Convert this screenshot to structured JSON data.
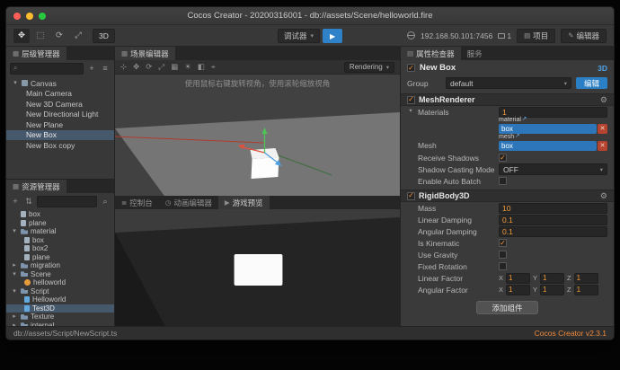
{
  "icons": {
    "chevron_down": "▾",
    "chevron_right": "▸",
    "check": "✓",
    "close": "✕",
    "plus": "+",
    "search": "⌕",
    "menu": "≡",
    "gear": "⚙",
    "play": "▶",
    "arrow_out": "↗",
    "sort": "⇅",
    "grid": "▦",
    "list": "≣",
    "clock": "◷",
    "pencil": "✎",
    "panel": "▤"
  },
  "window": {
    "title": "Cocos Creator - 20200316001 - db://assets/Scene/helloworld.fire"
  },
  "toolbar": {
    "tools": [
      "✥",
      "⬚",
      "⟳",
      "⤢"
    ],
    "mode_3d_label": "3D",
    "debugger_label": "调试器",
    "address": "192.168.50.101:7456",
    "device_count": "1",
    "project_label": "项目",
    "editor_label": "编辑器"
  },
  "hierarchy": {
    "title": "层级管理器",
    "items": [
      {
        "label": "Canvas"
      },
      {
        "label": "Main Camera"
      },
      {
        "label": "New 3D Camera"
      },
      {
        "label": "New Directional Light"
      },
      {
        "label": "New Plane"
      },
      {
        "label": "New Box"
      },
      {
        "label": "New Box copy"
      }
    ]
  },
  "assets": {
    "title": "资源管理器",
    "items": [
      {
        "label": "box"
      },
      {
        "label": "plane"
      },
      {
        "label": "material"
      },
      {
        "label": "box"
      },
      {
        "label": "box2"
      },
      {
        "label": "plane"
      },
      {
        "label": "migration"
      },
      {
        "label": "Scene"
      },
      {
        "label": "helloworld"
      },
      {
        "label": "Script"
      },
      {
        "label": "Helloworld"
      },
      {
        "label": "Test3D"
      },
      {
        "label": "Texture"
      },
      {
        "label": "internal"
      }
    ]
  },
  "scene": {
    "tab_title": "场景编辑器",
    "hint": "使用鼠标右键旋转视角，使用滚轮缩放视角",
    "rendering_label": "Rendering",
    "tools": [
      "⊹",
      "✥",
      "⟳",
      "⤢",
      "▦",
      "☀",
      "◧",
      "⌖"
    ]
  },
  "bottom_panel": {
    "tabs": [
      {
        "label": "控制台"
      },
      {
        "label": "动画编辑器"
      },
      {
        "label": "游戏预览"
      }
    ]
  },
  "inspector": {
    "tab_properties": "属性检查器",
    "tab_services": "服务",
    "node": {
      "name": "New Box",
      "badge": "3D"
    },
    "group": {
      "label": "Group",
      "value": "default",
      "edit_label": "编辑"
    },
    "mesh_renderer": {
      "title": "MeshRenderer",
      "materials_label": "Materials",
      "materials_count": "1",
      "material_tag": "material",
      "material_value": "box",
      "mesh_label": "Mesh",
      "mesh_tag": "mesh",
      "mesh_value": "box",
      "receive_shadows_label": "Receive Shadows",
      "shadow_mode_label": "Shadow Casting Mode",
      "shadow_mode_value": "OFF",
      "auto_batch_label": "Enable Auto Batch"
    },
    "rigidbody": {
      "title": "RigidBody3D",
      "mass_label": "Mass",
      "mass": "10",
      "linear_damping_label": "Linear Damping",
      "linear_damping": "0.1",
      "angular_damping_label": "Angular Damping",
      "angular_damping": "0.1",
      "is_kinematic_label": "Is Kinematic",
      "use_gravity_label": "Use Gravity",
      "fixed_rotation_label": "Fixed Rotation",
      "linear_factor_label": "Linear Factor",
      "angular_factor_label": "Angular Factor",
      "axis_x": "X",
      "axis_y": "Y",
      "axis_z": "Z",
      "linear_factor": {
        "x": "1",
        "y": "1",
        "z": "1"
      },
      "angular_factor": {
        "x": "1",
        "y": "1",
        "z": "1"
      }
    },
    "add_component_label": "添加组件"
  },
  "statusbar": {
    "path": "db://assets/Script/NewScript.ts",
    "version": "Cocos Creator v2.3.1"
  }
}
